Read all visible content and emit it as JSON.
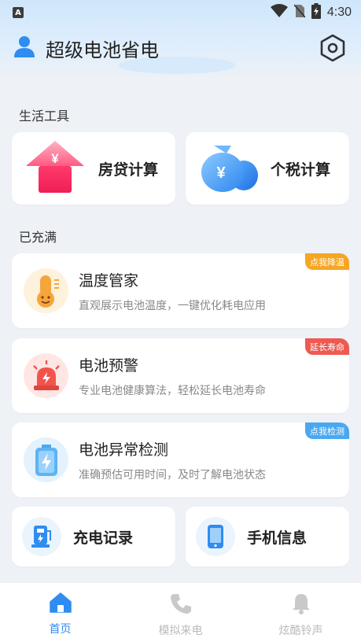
{
  "status_bar": {
    "indicator": "A",
    "time": "4:30",
    "icons": [
      "wifi-icon",
      "no-sim-icon",
      "battery-charging-icon"
    ]
  },
  "header": {
    "title": "超级电池省电",
    "icons": [
      "user-icon",
      "settings-icon"
    ]
  },
  "sections": {
    "tools_label": "生活工具",
    "charged_label": "已充满"
  },
  "tools": [
    {
      "label": "房贷计算",
      "icon": "house-yuan-icon"
    },
    {
      "label": "个税计算",
      "icon": "money-bag-yuan-icon"
    }
  ],
  "features": [
    {
      "title": "温度管家",
      "desc": "直观展示电池温度，一键优化耗电应用",
      "badge": "点我降温",
      "badge_color": "#f5a623",
      "icon": "thermometer-icon"
    },
    {
      "title": "电池预警",
      "desc": "专业电池健康算法，轻松延长电池寿命",
      "badge": "延长寿命",
      "badge_color": "#ee5a52",
      "icon": "alarm-light-icon"
    },
    {
      "title": "电池异常检测",
      "desc": "准确预估可用时间，及时了解电池状态",
      "badge": "点我检测",
      "badge_color": "#4aa8f0",
      "icon": "battery-bolt-icon"
    }
  ],
  "small_cards": [
    {
      "label": "充电记录",
      "icon": "charging-station-icon"
    },
    {
      "label": "手机信息",
      "icon": "phone-icon"
    }
  ],
  "nav": [
    {
      "label": "首页",
      "icon": "home-icon",
      "active": true
    },
    {
      "label": "模拟来电",
      "icon": "phone-call-icon",
      "active": false
    },
    {
      "label": "炫酷铃声",
      "icon": "bell-icon",
      "active": false
    }
  ],
  "colors": {
    "accent": "#2f8cf0",
    "background": "#eef1f6"
  }
}
